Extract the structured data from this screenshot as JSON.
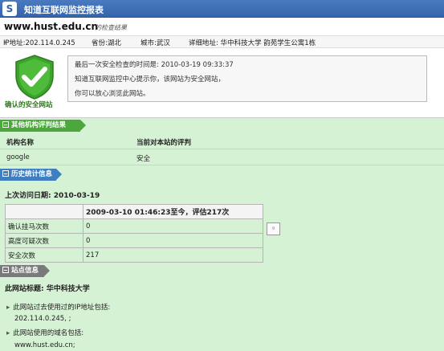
{
  "window": {
    "title": "知道互联网监控报表",
    "logo_letter": "S"
  },
  "site": {
    "domain": "www.hust.edu.cn",
    "subtitle": "的检查结果"
  },
  "info": {
    "ip": "IP地址:202.114.0.245",
    "province": "省份:湖北",
    "city": "城市:武汉",
    "address": "详细地址: 华中科技大学 韵苑学生公寓1栋"
  },
  "verdict": {
    "label": "确认的安全网站",
    "last_check": "最后一次安全检查的时间是: 2010-03-19 09:33:37",
    "line2": "知道互联网监控中心提示你，该网站为安全网站，",
    "line3": "你可以放心浏览此网站。"
  },
  "sections": {
    "other": {
      "title": "其他机构评判结果",
      "col1": "机构名称",
      "col2": "当前对本站的评判",
      "rows": [
        {
          "org": "google",
          "result": "安全"
        }
      ]
    },
    "history": {
      "title": "历史统计信息",
      "last_visit": "上次访问日期: 2010-03-19",
      "table_header": "2009-03-10 01:46:23至今，评估217次",
      "rows": [
        {
          "label": "确认挂马次数",
          "value": "0"
        },
        {
          "label": "高度可疑次数",
          "value": "0"
        },
        {
          "label": "安全次数",
          "value": "217"
        }
      ],
      "cal_icon_text": "ᵍ"
    },
    "site": {
      "title": "站点信息",
      "site_title": "此网站标题: 华中科技大学",
      "ip_intro": "此网站过去使用过的IP地址包括:",
      "ip_value": "202.114.0.245, ;",
      "alias_intro": "此网站使用的域名包括:",
      "alias_value": "www.hust.edu.cn;"
    }
  },
  "colors": {
    "green_bg": "#d6f2d4",
    "title_blue": "#3566ad",
    "sec_green": "#4ca83c",
    "sec_blue": "#3f7fbf",
    "sec_gray": "#7a7a7a"
  }
}
